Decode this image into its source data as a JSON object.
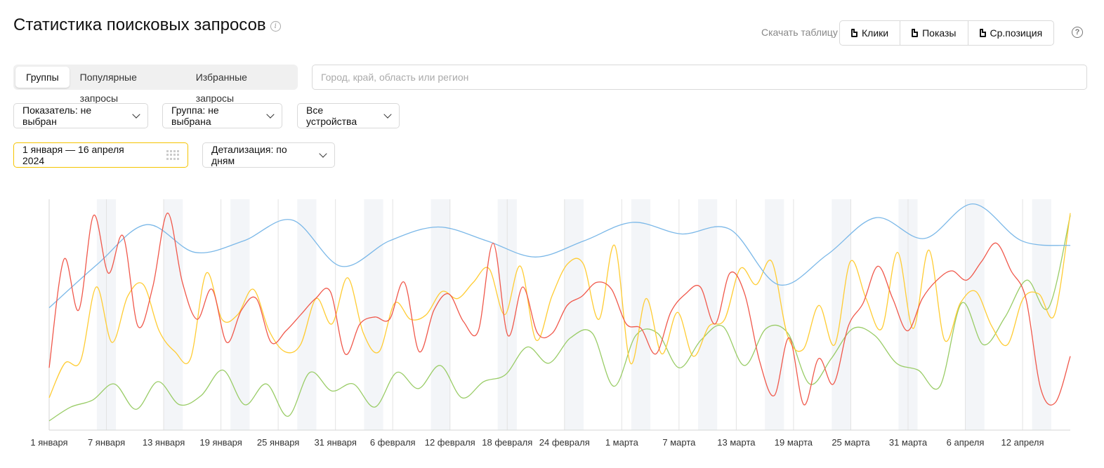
{
  "header": {
    "title": "Статистика поисковых запросов"
  },
  "download": {
    "label": "Скачать таблицу",
    "buttons": [
      "Клики",
      "Показы",
      "Ср.позиция"
    ]
  },
  "tabs": [
    {
      "label": "Группы",
      "active": true
    },
    {
      "label": "Популярные запросы",
      "active": false
    },
    {
      "label": "Избранные запросы",
      "active": false
    }
  ],
  "region": {
    "placeholder": "Город, край, область или регион"
  },
  "filters": {
    "indicator": "Показатель: не выбран",
    "group": "Группа: не выбрана",
    "devices": "Все устройства"
  },
  "period": {
    "range": "1 января — 16 апреля 2024",
    "detail": "Детализация: по дням"
  },
  "colors": {
    "blue": "#7bb8e8",
    "red": "#f0584b",
    "yellow": "#ffcc33",
    "green": "#99cc66",
    "accent": "#f5c400"
  },
  "chart_data": {
    "type": "line",
    "x_tick_labels": [
      "1 января",
      "7 января",
      "13 января",
      "19 января",
      "25 января",
      "31 января",
      "6 февраля",
      "12 февраля",
      "18 февраля",
      "24 февраля",
      "1 марта",
      "7 марта",
      "13 марта",
      "19 марта",
      "25 марта",
      "31 марта",
      "6 апреля",
      "12 апреля"
    ],
    "y_range": [
      0,
      100
    ],
    "grid": "vertical, weekends shaded",
    "series": [
      {
        "color": "#7bb8e8",
        "values": [
          53,
          72,
          89,
          77,
          82,
          91,
          71,
          82,
          88,
          82,
          75,
          82,
          90,
          85,
          87,
          63,
          76,
          92,
          83,
          98,
          82,
          80
        ]
      },
      {
        "color": "#f0584b",
        "values": [
          27,
          74,
          52,
          93,
          68,
          84,
          45,
          62,
          94,
          64,
          48,
          61,
          38,
          52,
          57,
          38,
          43,
          50,
          57,
          60,
          33,
          46,
          49,
          48,
          64,
          34,
          52,
          59,
          47,
          43,
          81,
          41,
          62,
          42,
          42,
          54,
          58,
          64,
          61,
          46,
          44,
          33,
          51,
          59,
          62,
          46,
          68,
          59,
          30,
          15,
          40,
          11,
          31,
          20,
          45,
          55,
          71,
          57,
          43,
          57,
          65,
          69,
          65,
          73,
          81,
          69,
          57,
          18,
          12,
          32
        ]
      },
      {
        "color": "#ffcc33",
        "values": [
          14,
          29,
          30,
          62,
          38,
          58,
          63,
          43,
          34,
          31,
          68,
          48,
          50,
          61,
          43,
          34,
          37,
          57,
          46,
          66,
          42,
          34,
          55,
          48,
          50,
          60,
          57,
          64,
          70,
          50,
          71,
          39,
          58,
          72,
          72,
          48,
          80,
          29,
          57,
          33,
          51,
          32,
          45,
          48,
          70,
          63,
          73,
          41,
          35,
          54,
          37,
          73,
          57,
          44,
          77,
          44,
          78,
          39,
          55,
          60,
          45,
          37,
          57,
          59,
          50,
          94
        ]
      },
      {
        "color": "#99cc66",
        "values": [
          4,
          10,
          13,
          20,
          9,
          21,
          11,
          15,
          26,
          11,
          20,
          6,
          25,
          17,
          20,
          10,
          25,
          18,
          28,
          14,
          21,
          24,
          36,
          29,
          40,
          42,
          19,
          41,
          42,
          27,
          39,
          45,
          28,
          44,
          42,
          20,
          31,
          44,
          41,
          29,
          26,
          19,
          55,
          37,
          49,
          65,
          53,
          93
        ]
      }
    ]
  }
}
